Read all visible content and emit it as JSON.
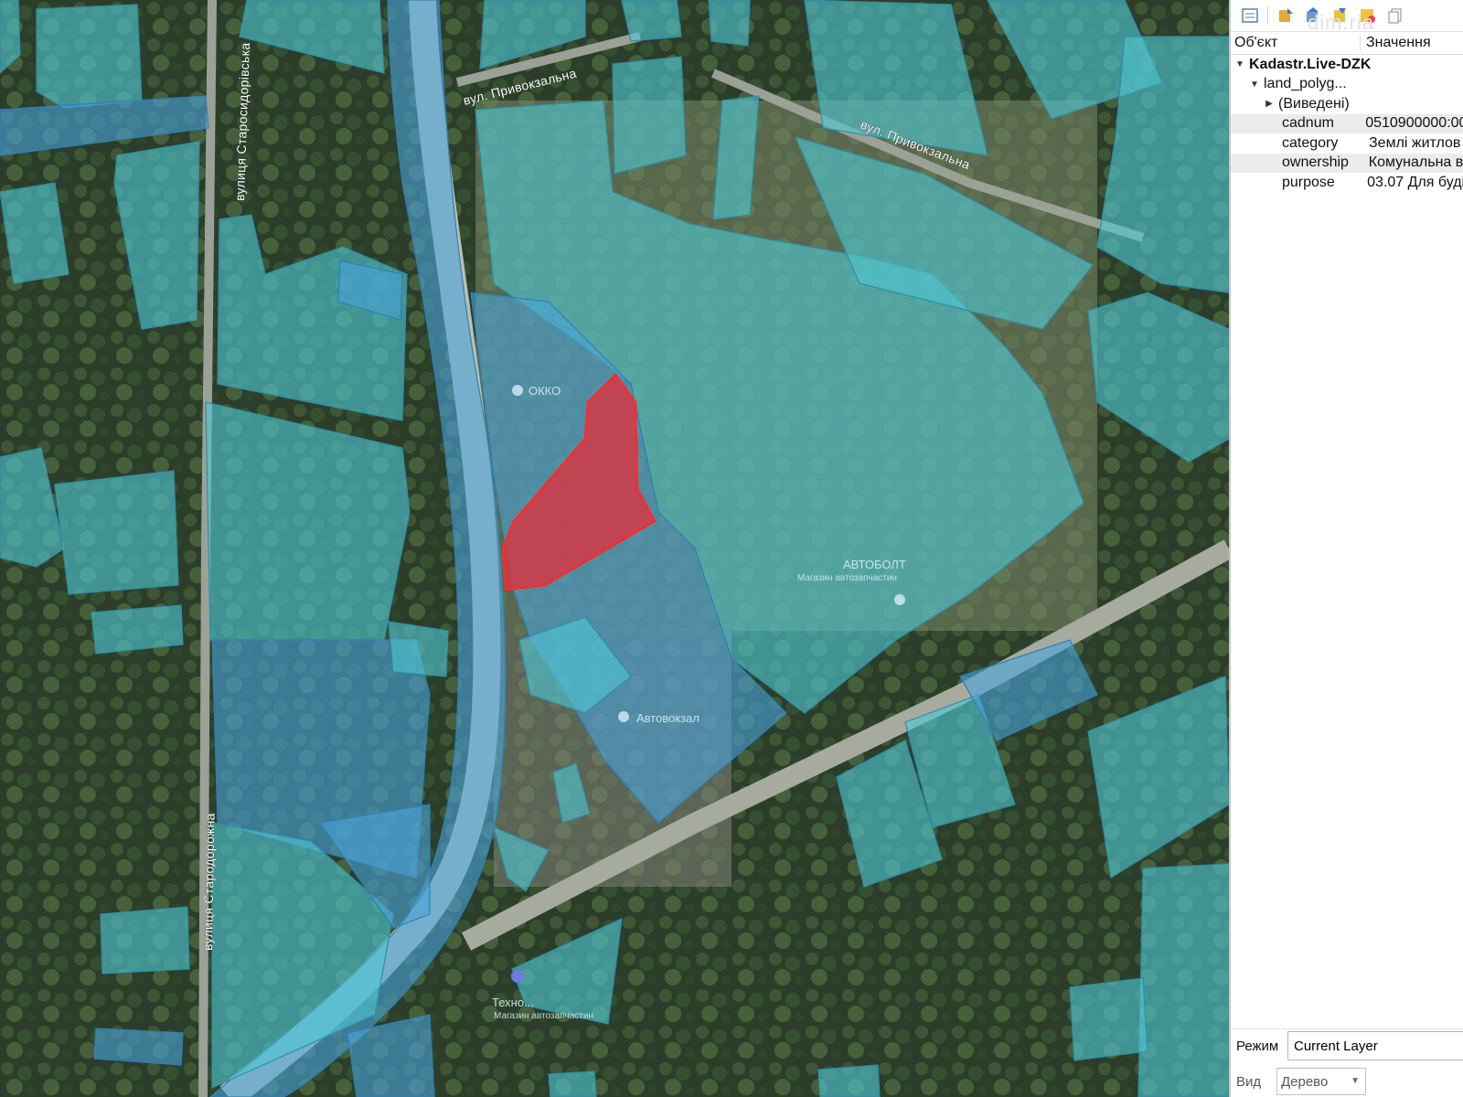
{
  "map": {
    "streets": {
      "starosydorivska": "вулиця Старосидорівська",
      "pryvokzalna_1": "вул. Привокзальна",
      "pryvokzalna_2": "вул. Привокзальна",
      "starodorozhna": "вулиця Стародорожна"
    },
    "pois": {
      "okko": "ОККО",
      "avtobolt": "АВТОБОЛТ",
      "avtobolt_sub": "Магазин автозапчастин",
      "avtovokzal": "Автовокзал",
      "tekhno": "Техно...",
      "tekhno_sub": "Магазин автозапчастин"
    },
    "colors": {
      "parcel_teal": "#4fc6d2",
      "parcel_blue": "#4aa3db",
      "parcel_selected": "#e0313c"
    }
  },
  "panel": {
    "watermark": "dim.ria",
    "toolbar_icons": [
      "expand-all-icon",
      "collapse-all-icon",
      "expand-layer-icon",
      "collapse-layer-icon",
      "highlight-icon",
      "copy-icon"
    ],
    "columns": {
      "object": "Об'єкт",
      "value": "Значення"
    },
    "tree": {
      "layer": "Kadastr.Live-DZK",
      "sublayer": "land_polyg...",
      "derived": "(Виведені)",
      "attributes": [
        {
          "key": "cadnum",
          "value": "0510900000:00"
        },
        {
          "key": "category",
          "value": "Землі житлов"
        },
        {
          "key": "ownership",
          "value": "Комунальна в"
        },
        {
          "key": "purpose",
          "value": "03.07 Для буді"
        }
      ]
    },
    "mode": {
      "label": "Режим",
      "value": "Current Layer"
    },
    "view": {
      "label": "Вид",
      "value": "Дерево"
    }
  }
}
